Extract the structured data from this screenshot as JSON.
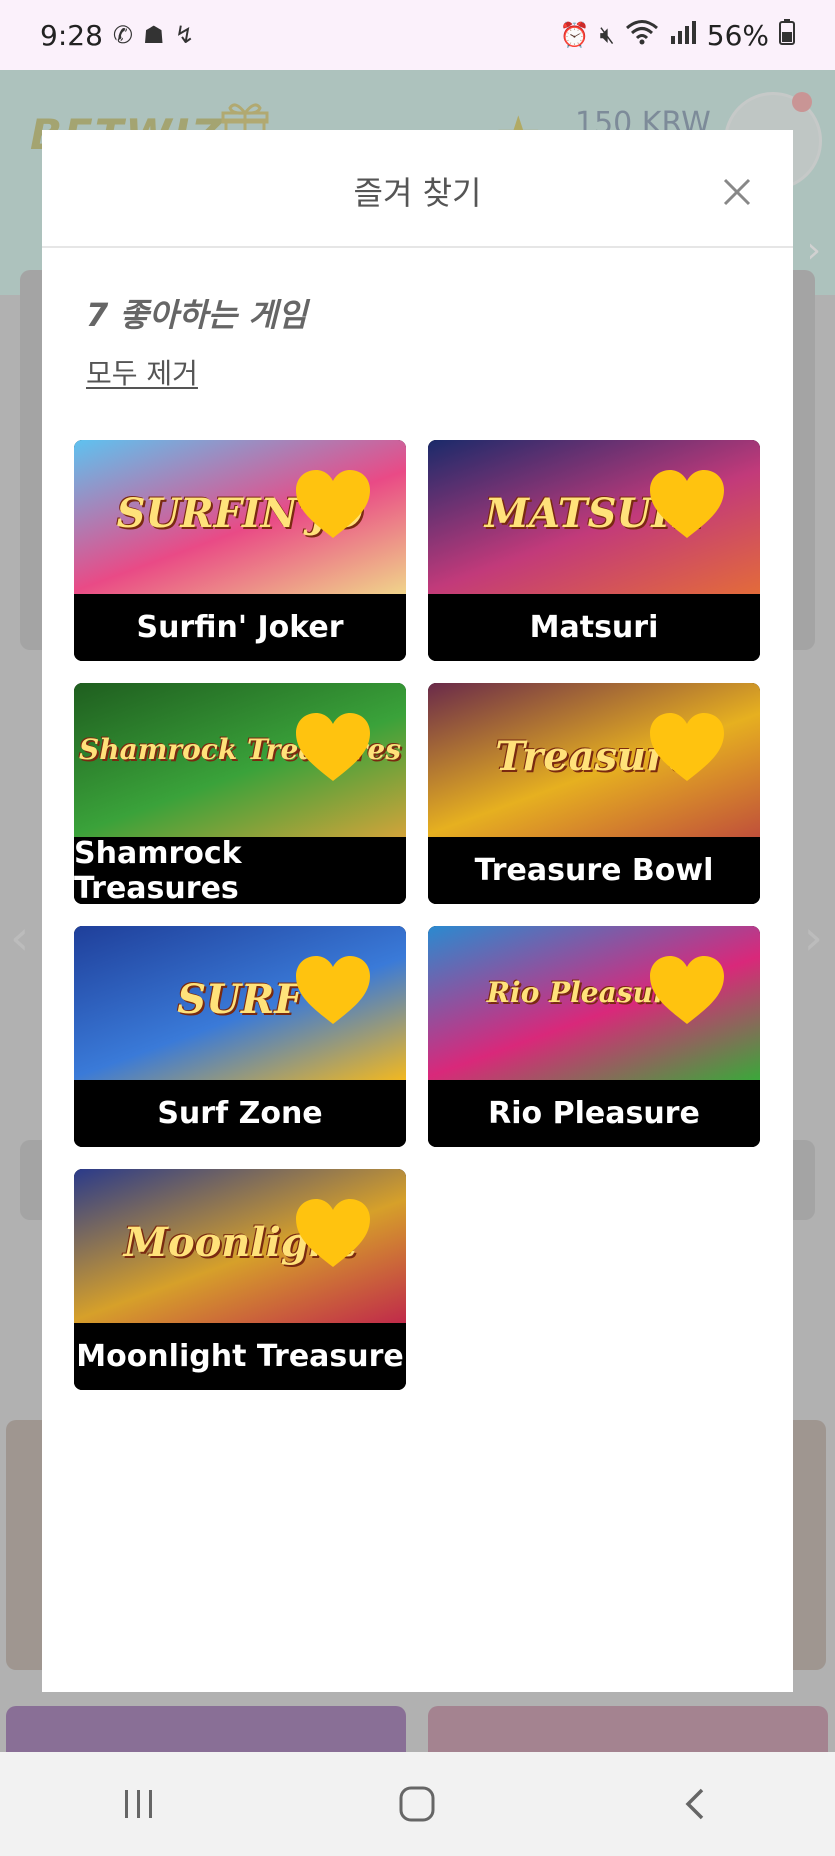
{
  "status_bar": {
    "time": "9:28",
    "battery": "56%",
    "left_icons": [
      "phone-call-icon",
      "bixby-icon",
      "missed-call-icon"
    ],
    "right_icons": [
      "alarm-icon",
      "mute-icon",
      "wifi-icon",
      "signal-icon",
      "battery-icon"
    ]
  },
  "background_app": {
    "logo": "BETWIZ",
    "balance": "150 KRW"
  },
  "modal": {
    "title": "즐겨 찾기",
    "favorites_count_label": "7 좋아하는 게임",
    "clear_all_label": "모두 제거",
    "games": [
      {
        "name": "Surfin' Joker",
        "art_text": "SURFIN'JO",
        "art_colors": [
          "#5ec2f0",
          "#e94a86",
          "#f0d48a"
        ]
      },
      {
        "name": "Matsuri",
        "art_text": "MATSURI",
        "art_colors": [
          "#1a2a6a",
          "#c23a7a",
          "#e36b3a"
        ]
      },
      {
        "name": "Shamrock Treasures",
        "art_text": "Shamrock Treasures",
        "art_colors": [
          "#1f5e1f",
          "#3aa23a",
          "#d2a33a"
        ]
      },
      {
        "name": "Treasure Bowl",
        "art_text": "Treasure",
        "art_colors": [
          "#6a2a4a",
          "#e6b020",
          "#c0503a"
        ]
      },
      {
        "name": "Surf Zone",
        "art_text": "SURF",
        "art_colors": [
          "#1f3f9a",
          "#3a7ad8",
          "#f2b820"
        ]
      },
      {
        "name": "Rio Pleasure",
        "art_text": "Rio Pleasures",
        "art_colors": [
          "#2a8ad0",
          "#d9287a",
          "#3aa83a"
        ]
      },
      {
        "name": "Moonlight Treasure",
        "art_text": "Moonlight",
        "art_colors": [
          "#2a3a8a",
          "#d6a02a",
          "#c02a4a"
        ]
      }
    ],
    "heart_color": "#ffc30f"
  },
  "nav_bar": {
    "buttons": [
      "recents-icon",
      "home-icon",
      "back-icon"
    ]
  }
}
